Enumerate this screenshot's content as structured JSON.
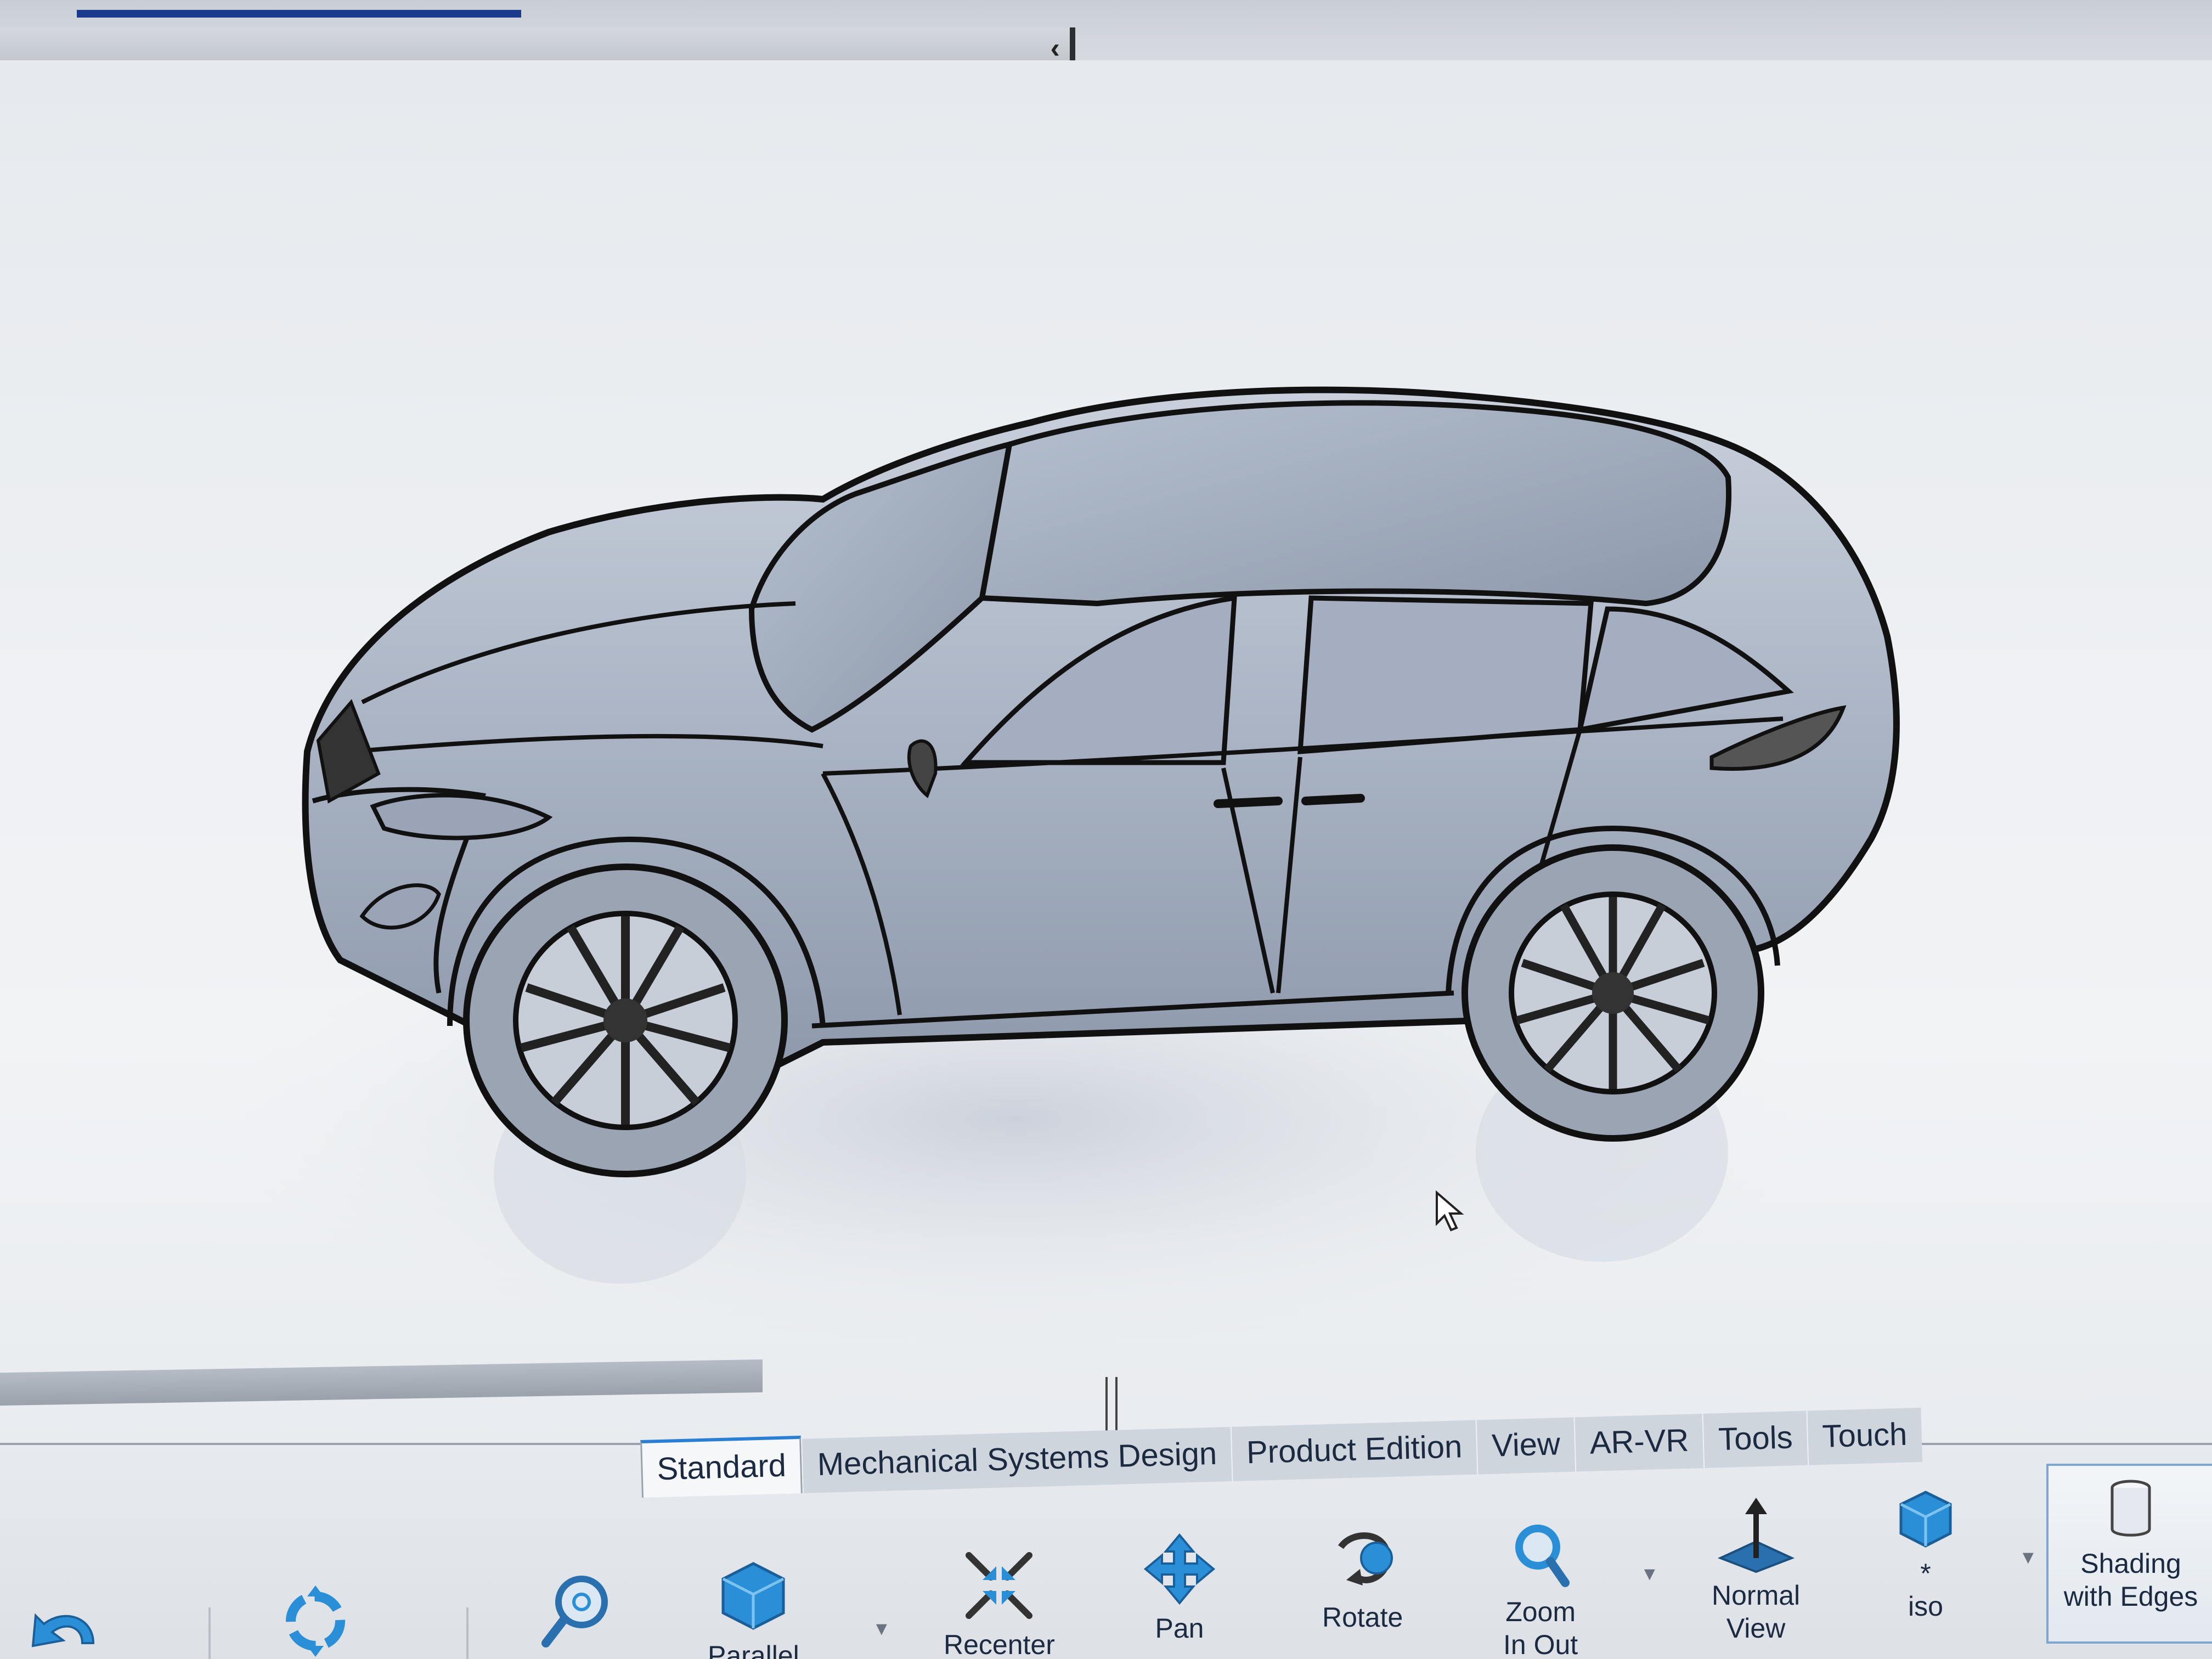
{
  "top_panel": {
    "collapse_glyph": "‹"
  },
  "ribbon": {
    "tabs": [
      {
        "label": "Standard",
        "active": true
      },
      {
        "label": "Mechanical Systems Design",
        "active": false
      },
      {
        "label": "Product Edition",
        "active": false
      },
      {
        "label": "View",
        "active": false
      },
      {
        "label": "AR-VR",
        "active": false
      },
      {
        "label": "Tools",
        "active": false
      },
      {
        "label": "Touch",
        "active": false
      }
    ],
    "tools": {
      "parallel": "Parallel",
      "recenter": "Recenter",
      "pan": "Pan",
      "rotate": "Rotate",
      "zoom_line1": "Zoom",
      "zoom_line2": "In Out",
      "normal_line1": "Normal",
      "normal_line2": "View",
      "iso_marker": "*",
      "iso": "iso",
      "shading_line1": "Shading",
      "shading_line2": "with Edges"
    },
    "icons": [
      "undo-icon",
      "fit-all-icon",
      "zoom-area-icon",
      "parallel-cube-icon",
      "recenter-icon",
      "pan-icon",
      "rotate-icon",
      "zoom-icon",
      "normal-view-icon",
      "iso-cube-icon",
      "shading-with-edges-icon"
    ]
  },
  "colors": {
    "icon_blue": "#2a8fd6",
    "active_tab_accent": "#2a7fd4",
    "progress_bar": "#1a3a8e",
    "car_outline": "#111111",
    "car_body": "#aeb8c8"
  }
}
